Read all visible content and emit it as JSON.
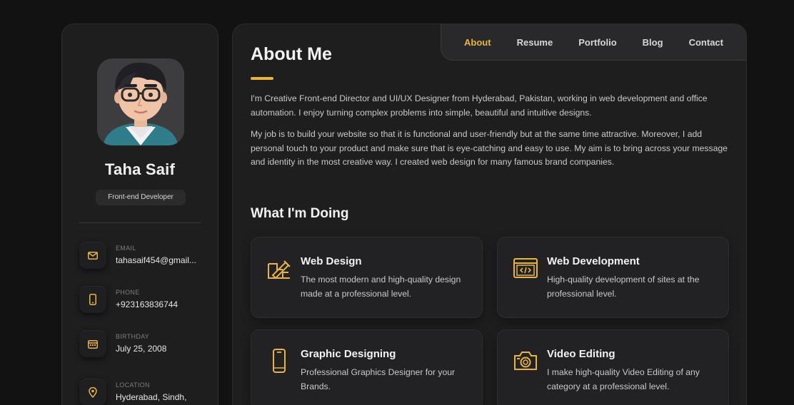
{
  "sidebar": {
    "name": "Taha Saif",
    "title": "Front-end Developer",
    "contacts": [
      {
        "label": "EMAIL",
        "value": "tahasaif454@gmail...",
        "icon": "mail-icon"
      },
      {
        "label": "PHONE",
        "value": "+923163836744",
        "icon": "phone-icon"
      },
      {
        "label": "BIRTHDAY",
        "value": "July 25, 2008",
        "icon": "calendar-icon"
      },
      {
        "label": "LOCATION",
        "value": "Hyderabad, Sindh, Pakistan",
        "icon": "location-pin-icon"
      }
    ]
  },
  "nav": {
    "items": [
      "About",
      "Resume",
      "Portfolio",
      "Blog",
      "Contact"
    ],
    "active": "About"
  },
  "about": {
    "heading": "About Me",
    "paragraphs": [
      "I'm Creative Front-end Director and UI/UX Designer from Hyderabad, Pakistan, working in web development and office automation. I enjoy turning complex problems into simple, beautiful and intuitive designs.",
      "My job is to build your website so that it is functional and user-friendly but at the same time attractive. Moreover, I add personal touch to your product and make sure that is eye-catching and easy to use. My aim is to bring across your message and identity in the most creative way. I created web design for many famous brand companies."
    ]
  },
  "services": {
    "heading": "What I'm Doing",
    "items": [
      {
        "title": "Web Design",
        "description": "The most modern and high-quality design made at a professional level.",
        "icon": "design-icon"
      },
      {
        "title": "Web Development",
        "description": "High-quality development of sites at the professional level.",
        "icon": "code-icon"
      },
      {
        "title": "Graphic Designing",
        "description": "Professional Graphics Designer for your Brands.",
        "icon": "smartphone-icon"
      },
      {
        "title": "Video Editing",
        "description": "I make high-quality Video Editing of any category at a professional level.",
        "icon": "camera-icon"
      }
    ]
  },
  "colors": {
    "accent": "#e8b43d",
    "background": "#121212",
    "panel": "#1e1e1f"
  }
}
